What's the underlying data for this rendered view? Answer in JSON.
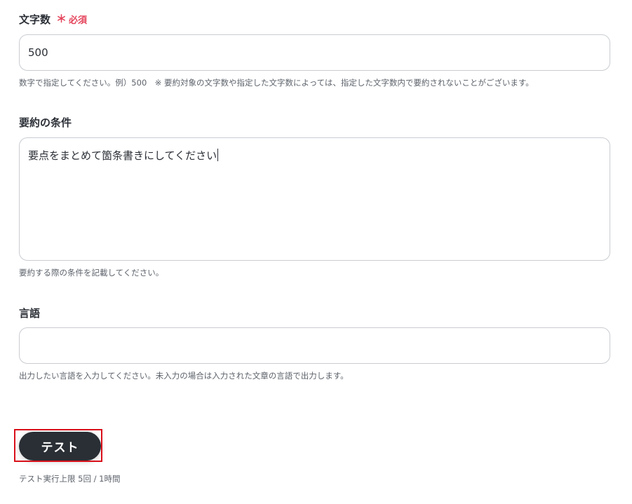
{
  "fields": {
    "char_count": {
      "label": "文字数",
      "required_mark": "＊",
      "required_text": "必須",
      "value": "500",
      "help": "数字で指定してください。例）500　※ 要約対象の文字数や指定した文字数によっては、指定した文字数内で要約されないことがございます。"
    },
    "conditions": {
      "label": "要約の条件",
      "value": "要点をまとめて箇条書きにしてください",
      "help": "要約する際の条件を記載してください。"
    },
    "language": {
      "label": "言語",
      "value": "",
      "help": "出力したい言語を入力してください。未入力の場合は入力された文章の言語で出力します。"
    }
  },
  "actions": {
    "test_label": "テスト",
    "limit_note": "テスト実行上限 5回 / 1時間"
  },
  "colors": {
    "required": "#e5445b",
    "button_bg": "#2a2f35",
    "highlight": "#d9101a"
  }
}
